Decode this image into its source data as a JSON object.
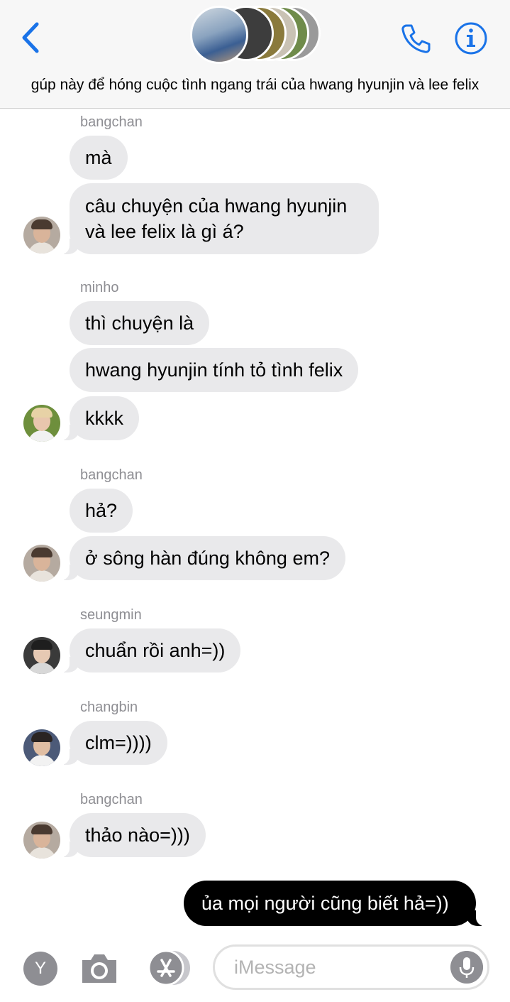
{
  "header": {
    "group_name": "gúp này để hóng cuộc tình ngang trái của hwang hyunjin và lee felix",
    "back_icon": "chevron-left-icon",
    "call_icon": "phone-icon",
    "info_icon": "info-icon",
    "accent_color": "#1a73e8"
  },
  "messages": [
    {
      "sender": "bangchan",
      "bubbles": [
        "mà",
        "câu chuyện của hwang hyunjin\nvà lee felix là gì á?"
      ]
    },
    {
      "sender": "minho",
      "bubbles": [
        "thì chuyện là",
        "hwang hyunjin tính tỏ tình felix",
        "kkkk"
      ]
    },
    {
      "sender": "bangchan",
      "bubbles": [
        "hả?",
        "ở sông hàn đúng không em?"
      ]
    },
    {
      "sender": "seungmin",
      "bubbles": [
        "chuẩn rồi anh=))"
      ]
    },
    {
      "sender": "changbin",
      "bubbles": [
        "clm=))))"
      ]
    },
    {
      "sender": "bangchan",
      "bubbles": [
        "thảo nào=)))"
      ]
    }
  ],
  "outgoing": {
    "text": "ủa mọi người cũng biết hả=))"
  },
  "composer": {
    "placeholder": "iMessage",
    "app_button_letter": "Y",
    "camera_icon": "camera-icon",
    "appstore_icon": "app-store-icon",
    "mic_icon": "microphone-icon"
  },
  "colors": {
    "incoming_bubble": "#e9e9eb",
    "outgoing_bubble": "#000000",
    "sender_label": "#8e8e93"
  }
}
